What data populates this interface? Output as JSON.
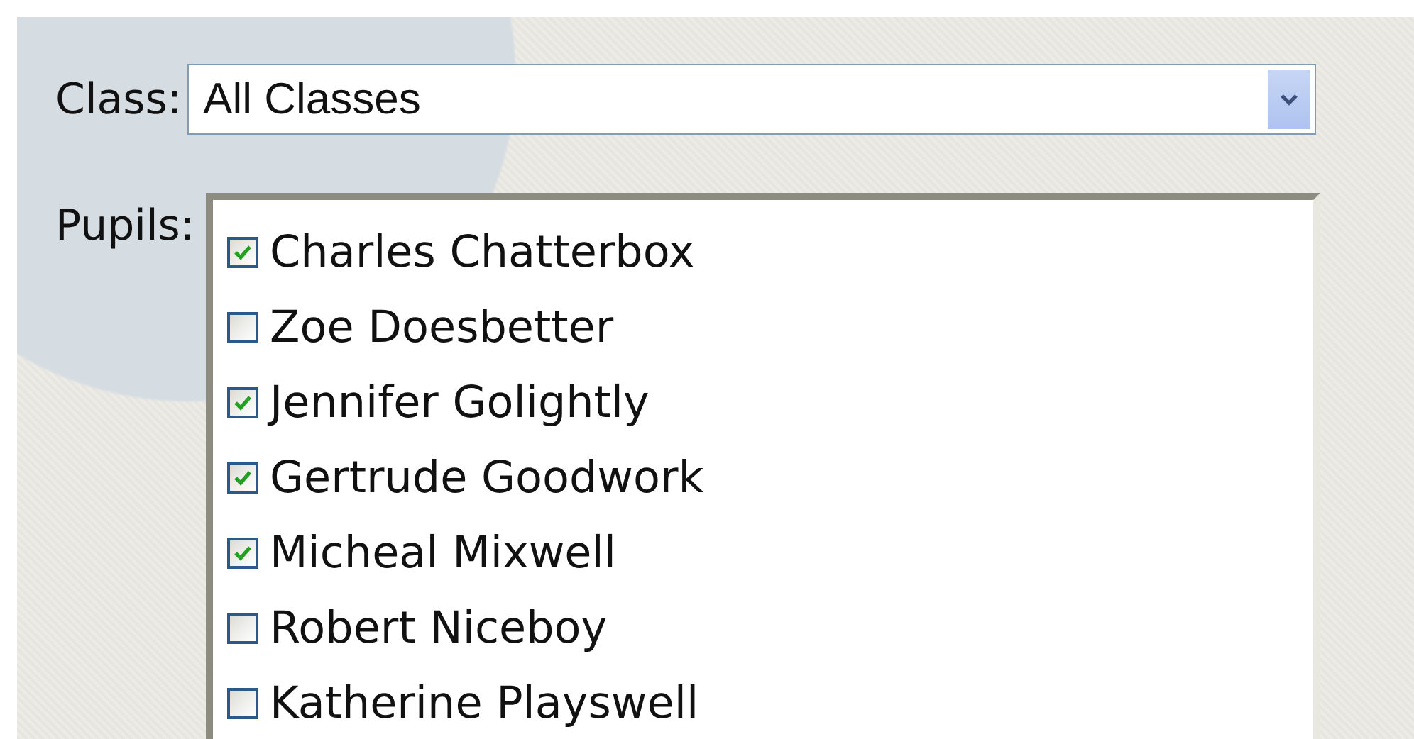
{
  "class_filter": {
    "label": "Class:",
    "value": "All Classes"
  },
  "pupils": {
    "label": "Pupils:",
    "items": [
      {
        "name": "Charles Chatterbox",
        "checked": true
      },
      {
        "name": "Zoe Doesbetter",
        "checked": false
      },
      {
        "name": "Jennifer Golightly",
        "checked": true
      },
      {
        "name": "Gertrude Goodwork",
        "checked": true
      },
      {
        "name": "Micheal Mixwell",
        "checked": true
      },
      {
        "name": "Robert Niceboy",
        "checked": false
      },
      {
        "name": "Katherine Playswell",
        "checked": false
      }
    ]
  }
}
